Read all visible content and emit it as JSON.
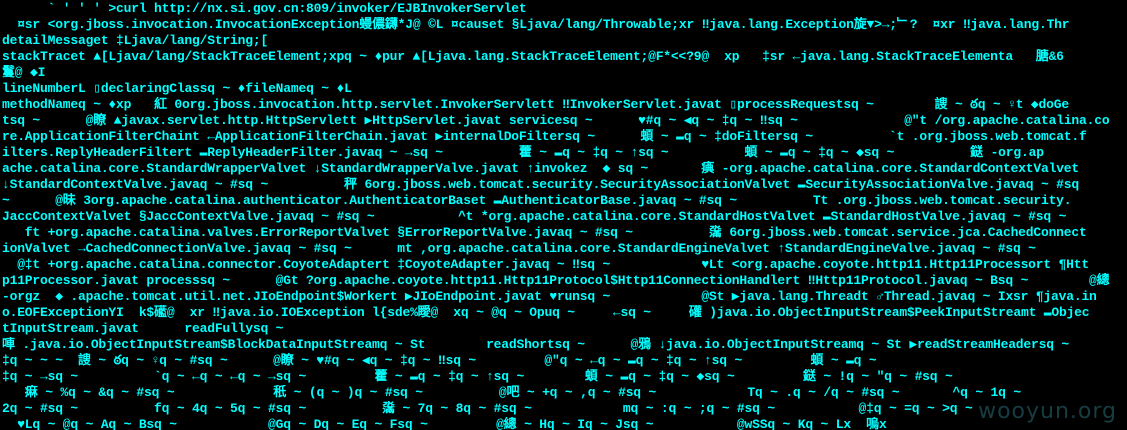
{
  "terminal": {
    "text_color": "#00ffff",
    "background_color": "#000000",
    "lines": [
      "      ` ' ' ' >curl http://nx.si.gov.cn:809/invoker/EJBInvokerServlet",
      "  ¤sr <org.jboss.invocation.InvocationException蟃儂鑮*J@ ©L ¤causet §Ljava/lang/Throwable;xr ‼java.lang.Exception旋▼>→;﹂?  ¤xr ‼java.lang.Thr",
      "detailMessaget ‡Ljava/lang/String;[",
      "stackTracet ▲[Ljava/lang/StackTraceElement;xpq ~ ♦pur ▲[Ljava.lang.StackTraceElement;@F*<<?9@  xp   ‡sr ←java.lang.StackTraceElementa   膅&6",
      "鬘@ ◆I",
      "lineNumberL ▯declaringClassq ~ ♦fileNameq ~ ♦L",
      "methodNameq ~ ♦xp   紅 0org.jboss.invocation.http.servlet.InvokerServlett ‼InvokerServlet.javat ▯processRequestsq ~        謏 ~ ఠq ~ ♀t ◆doGe",
      "tsq ~      @瞭 ▲javax.servlet.http.HttpServlett ▶HttpServlet.javat servicesq ~      ♥#q ~ ◀q ~ ‡q ~ ‼sq ~              @\"t /org.apache.catalina.co",
      "re.ApplicationFilterChaint ←ApplicationFilterChain.javat ▶internalDoFiltersq ~      蝢 ~ ▬q ~ ‡doFiltersq ~          `t .org.jboss.web.tomcat.f",
      "ilters.ReplyHeaderFiltert ▬ReplyHeaderFilter.javaq ~ →sq ~          藿 ~ ▬q ~ ‡q ~ ↑sq ~          蝢 ~ ▬q ~ ‡q ~ ◆sq ~          鎹 -org.ap",
      "ache.catalina.core.StandardWrapperValvet ↓StandardWrapperValve.javat ↑invokez  ◆ sq ~       痶 -org.apache.catalina.core.StandardContextValvet",
      "↓StandardContextValve.javaq ~ #sq ~          秤 6org.jboss.web.tomcat.security.SecurityAssociationValvet ▬SecurityAssociationValve.javaq ~ #sq",
      "~      @昧 3org.apache.catalina.authenticator.AuthenticatorBaset ▬AuthenticatorBase.javaq ~ #sq ~          Tt .org.jboss.web.tomcat.security.",
      "JaccContextValvet §JaccContextValve.javaq ~ #sq ~           ^t *org.apache.catalina.core.StandardHostValvet ▬StandardHostValve.javaq ~ #sq ~",
      "   ft +org.apache.catalina.valves.ErrorReportValvet §ErrorReportValve.javaq ~ #sq ~          濷 6org.jboss.web.tomcat.service.jca.CachedConnect",
      "ionValvet →CachedConnectionValve.javaq ~ #sq ~      mt ,org.apache.catalina.core.StandardEngineValvet ↑StandardEngineValve.javaq ~ #sq ~",
      "  @‡t +org.apache.catalina.connector.CoyoteAdaptert ‡CoyoteAdapter.javaq ~ ‼sq ~            ♥Lt <org.apache.coyote.http11.Http11Processort ¶Htt",
      "p11Processor.javat processsq ~      @Gt ?org.apache.coyote.http11.Http11Protocol$Http11ConnectionHandlert ‼Http11Protocol.javaq ~ Bsq ~        @總",
      "-orgz  ◆ .apache.tomcat.util.net.JIoEndpoint$Workert ▶JIoEndpoint.javat ♥runsq ~            @St ▶java.lang.Threadt ♂Thread.javaq ~ Ixsr ¶java.in",
      "o.EOFExceptionYI  k$礷@  xr ‼java.io.IOException l{sde%瞹@  xq ~ @q ~ Opuq ~     ←sq ~     礶 )java.io.ObjectInputStream$PeekInputStreamt ▬Objec",
      "tInputStream.javat      readFullysq ~",
      "唓 .java.io.ObjectInputStream$BlockDataInputStreamq ~ St        readShortsq ~      @鴉 ↓java.io.ObjectInputStreamq ~ St ▶readStreamHeadersq ~",
      "‡q ~ ~ ~  謏 ~ ఠq ~ ♀q ~ #sq ~      @瞭 ~ ♥#q ~ ◀q ~ ‡q ~ ‼sq ~         @\"q ~ ←q ~ ▬q ~ ‡q ~ ↑sq ~         蝢 ~ ▬q ~",
      "‡q ~ →sq ~          `q ~ ←q ~ ←q ~ →sq ~         藿 ~ ▬q ~ ‡q ~ ↑sq ~        蝢 ~ ▬q ~ ‡q ~ ◆sq ~         鎹 ~ !q ~ \"q ~ #sq ~",
      "   痳 ~ %q ~ &q ~ #sq ~             秖 ~ (q ~ )q ~ #sq ~          @吧 ~ +q ~ ,q ~ #sq ~            Tq ~ .q ~ /q ~ #sq ~       ^q ~ 1q ~",
      "2q ~ #sq ~          fq ~ 4q ~ 5q ~ #sq ~          濷 ~ 7q ~ 8q ~ #sq ~            mq ~ :q ~ ;q ~ #sq ~           @‡q ~ =q ~ >q ~",
      "  ♥Lq ~ @q ~ Aq ~ Bsq ~            @Gq ~ Dq ~ Eq ~ Fsq ~         @總 ~ Hq ~ Iq ~ Jsq ~           @wSSq ~ Kq ~ Lx  嗚x"
    ]
  },
  "watermark": {
    "text": "wooyun.org"
  }
}
